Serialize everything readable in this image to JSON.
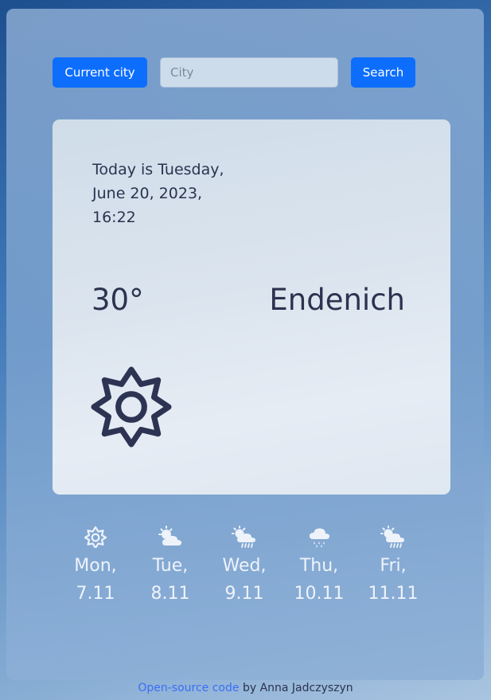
{
  "search": {
    "current_city_label": "Current city",
    "city_placeholder": "City",
    "search_label": "Search"
  },
  "current": {
    "date_line_1": "Today is Tuesday,",
    "date_line_2": "June 20, 2023,",
    "time": "16:22",
    "temperature": "30°",
    "city": "Endenich",
    "icon": "sun-icon"
  },
  "forecast": [
    {
      "day": "Mon,",
      "date": "7.11",
      "icon": "sun-icon"
    },
    {
      "day": "Tue,",
      "date": "8.11",
      "icon": "partly-cloudy-icon"
    },
    {
      "day": "Wed,",
      "date": "9.11",
      "icon": "sun-cloud-rain-icon"
    },
    {
      "day": "Thu,",
      "date": "10.11",
      "icon": "cloud-rain-icon"
    },
    {
      "day": "Fri,",
      "date": "11.11",
      "icon": "sun-cloud-rain-icon"
    }
  ],
  "footer": {
    "link_text": "Open-source code",
    "author_text": " by Anna Jadczyszyn"
  },
  "colors": {
    "accent": "#0d6efd",
    "text_dark": "#2b3350",
    "link": "#3b6ef5"
  }
}
